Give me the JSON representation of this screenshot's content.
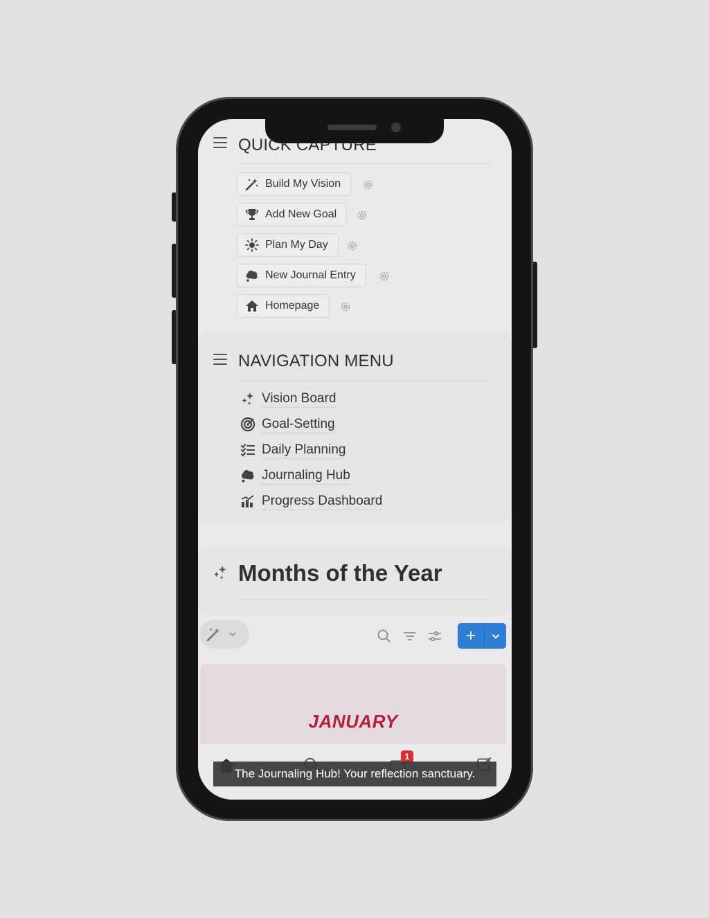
{
  "quick_capture": {
    "title": "QUICK CAPTURE",
    "buttons": [
      {
        "label": "Build My Vision",
        "icon": "magic-wand-icon"
      },
      {
        "label": "Add New Goal",
        "icon": "trophy-icon"
      },
      {
        "label": "Plan My Day",
        "icon": "sun-icon"
      },
      {
        "label": "New Journal Entry",
        "icon": "thought-bubble-icon"
      },
      {
        "label": "Homepage",
        "icon": "home-icon"
      }
    ]
  },
  "navigation_menu": {
    "title": "NAVIGATION MENU",
    "items": [
      {
        "label": "Vision Board",
        "icon": "sparkles-icon"
      },
      {
        "label": "Goal-Setting",
        "icon": "target-icon"
      },
      {
        "label": "Daily Planning",
        "icon": "checklist-icon"
      },
      {
        "label": "Journaling Hub",
        "icon": "thought-bubble-icon"
      },
      {
        "label": "Progress Dashboard",
        "icon": "chart-icon"
      }
    ]
  },
  "months_section": {
    "title": "Months of the Year",
    "first_month": "JANUARY",
    "new_button": "+"
  },
  "notification_count": "1",
  "caption": "The Journaling Hub! Your reflection sanctuary.",
  "colors": {
    "accent": "#2f7fd6",
    "month_text": "#b31d3c",
    "background": "#e3e1e4"
  }
}
